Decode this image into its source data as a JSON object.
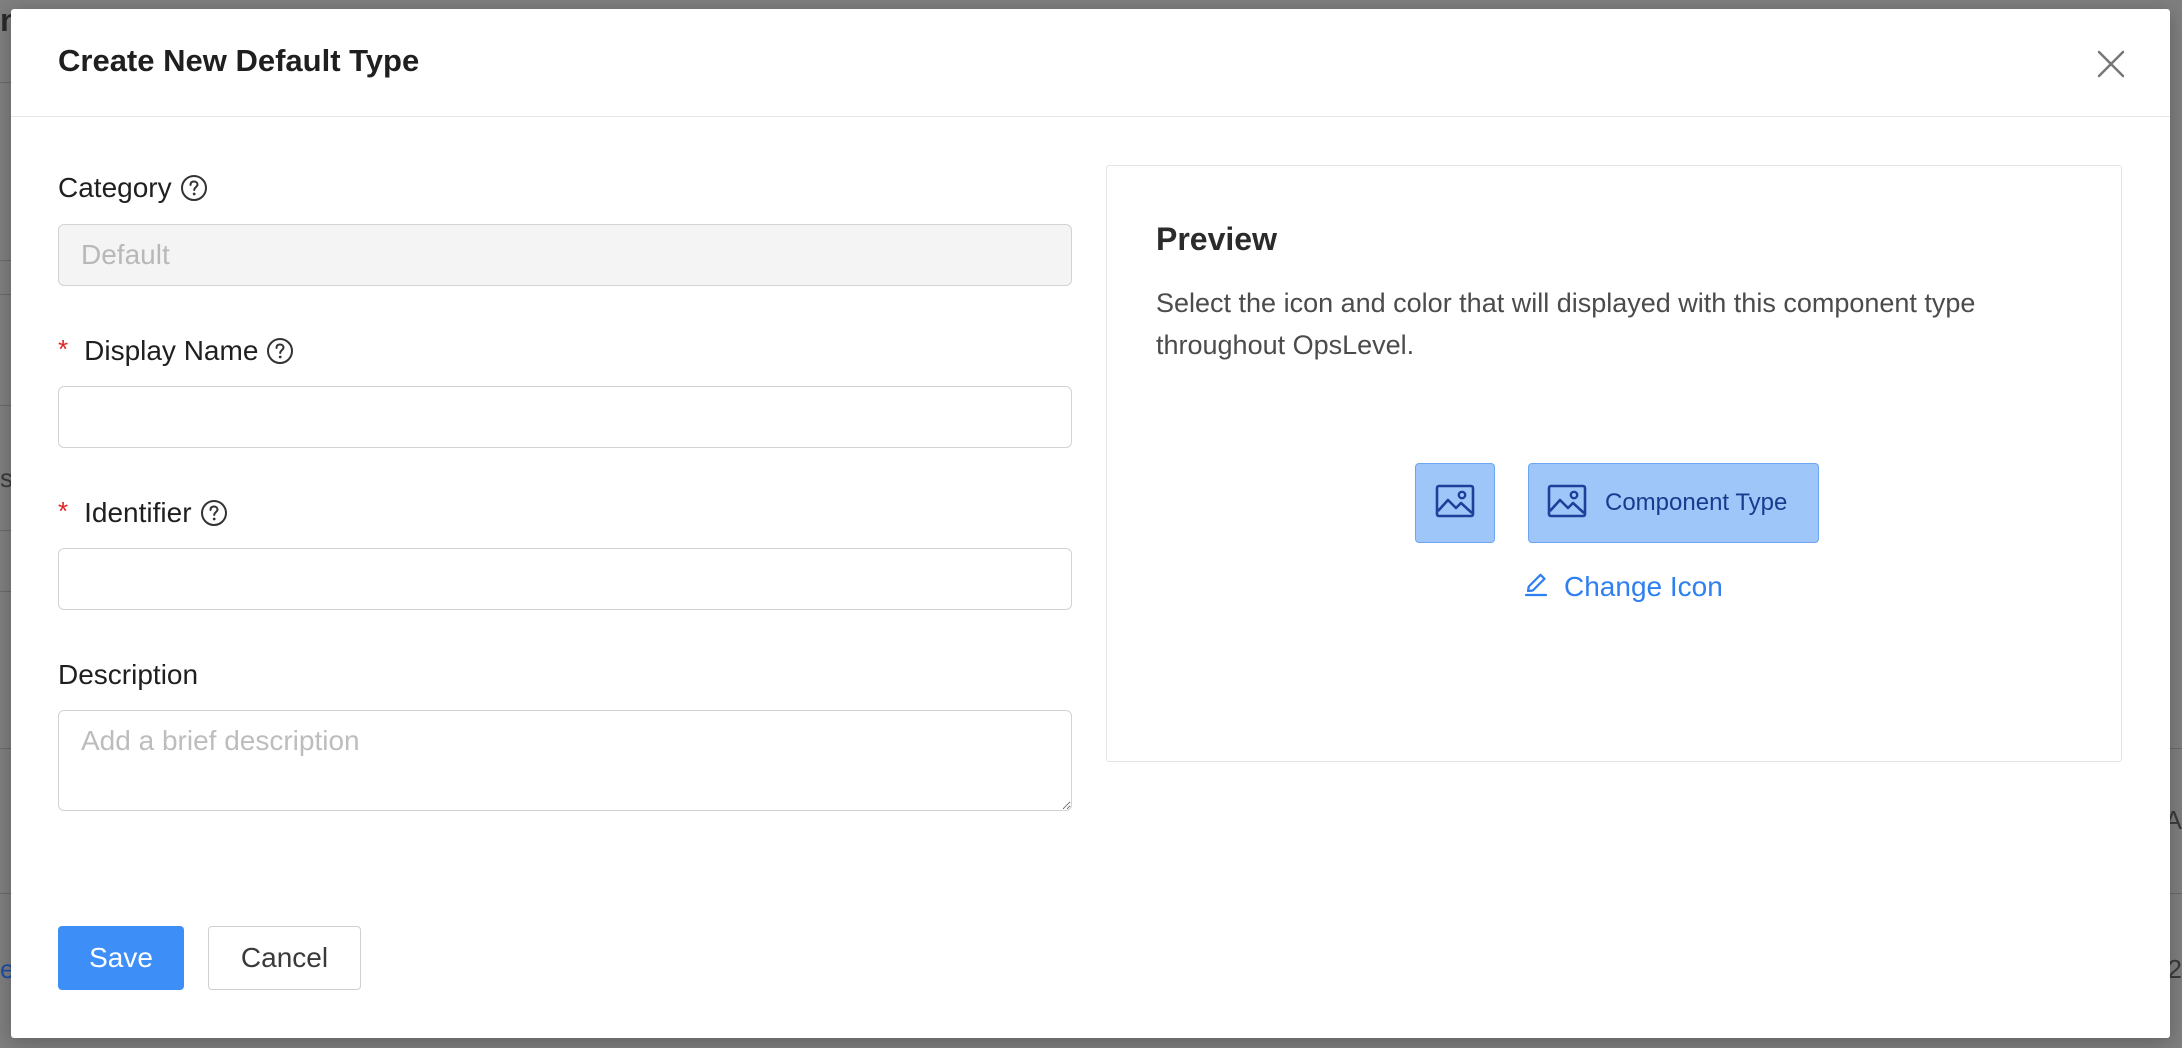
{
  "background": {
    "left_fragments": [
      "n",
      "s",
      "e"
    ],
    "right_fragments": [
      "A",
      "2"
    ]
  },
  "modal": {
    "title": "Create New Default Type",
    "close_icon": "close-icon"
  },
  "form": {
    "category": {
      "label": "Category",
      "value": "Default",
      "disabled": true
    },
    "display_name": {
      "label": "Display Name",
      "required_mark": "*",
      "value": ""
    },
    "identifier": {
      "label": "Identifier",
      "required_mark": "*",
      "value": ""
    },
    "description": {
      "label": "Description",
      "placeholder": "Add a brief description",
      "value": ""
    }
  },
  "preview": {
    "title": "Preview",
    "description": "Select the icon and color that will displayed with this component type throughout OpsLevel.",
    "chip_label": "Component Type",
    "change_icon_label": "Change Icon",
    "icon": "image-icon"
  },
  "actions": {
    "save_label": "Save",
    "cancel_label": "Cancel"
  },
  "colors": {
    "primary": "#3d8ef6",
    "link": "#2e7ff0",
    "required": "#e02424",
    "chip_bg": "#9ec6f9",
    "chip_border": "#6ea5f2",
    "chip_text": "#1a3a8f"
  }
}
